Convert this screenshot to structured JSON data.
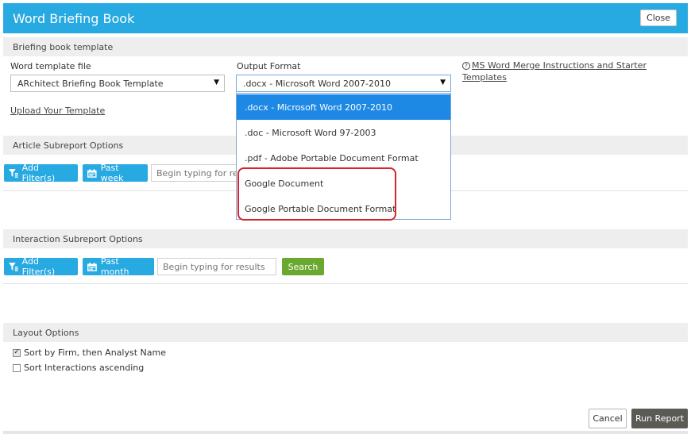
{
  "dialog": {
    "title": "Word Briefing Book",
    "close_label": "Close"
  },
  "briefing": {
    "section_title": "Briefing book template",
    "template_label": "Word template file",
    "template_value": "ARchitect Briefing Book Template",
    "output_label": "Output Format",
    "output_value": ".docx - Microsoft Word 2007-2010",
    "upload_link": "Upload Your Template",
    "help_link": "MS Word Merge Instructions and Starter Templates"
  },
  "output_options": [
    ".docx - Microsoft Word 2007-2010",
    ".doc - Microsoft Word 97-2003",
    ".pdf - Adobe Portable Document Format",
    "Google Document",
    "Google Portable Document Format"
  ],
  "article": {
    "section_title": "Article Subreport Options",
    "add_filter": "Add Filter(s)",
    "date_range": "Past week",
    "search_placeholder": "Begin typing for results"
  },
  "interaction": {
    "section_title": "Interaction Subreport Options",
    "add_filter": "Add Filter(s)",
    "date_range": "Past month",
    "search_placeholder": "Begin typing for results",
    "search_button": "Search"
  },
  "layout": {
    "section_title": "Layout Options",
    "options": [
      {
        "label": "Sort by Firm, then Analyst Name",
        "checked": true
      },
      {
        "label": "Sort Interactions ascending",
        "checked": false
      }
    ]
  },
  "footer": {
    "cancel_label": "Cancel",
    "run_label": "Run Report"
  },
  "colors": {
    "accent": "#27a9e1",
    "search_green": "#6aa830",
    "run_dark": "#5c5a55",
    "highlight_red": "#d9242f",
    "selected_blue": "#1e88e5"
  },
  "icons": [
    "filter-icon",
    "calendar-icon",
    "question-circle-icon",
    "dropdown-arrow-icon",
    "checkbox-icon"
  ]
}
